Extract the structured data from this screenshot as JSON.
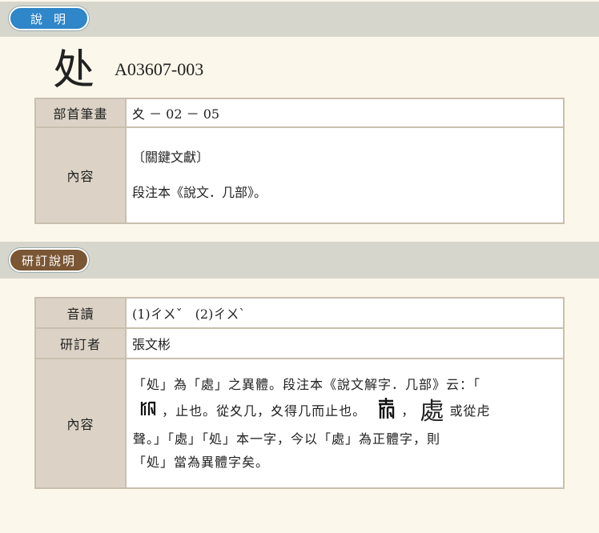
{
  "section1": {
    "tab_label": "說明"
  },
  "header": {
    "character": "处",
    "code": "A03607-003"
  },
  "table1": {
    "radical_label": "部首筆畫",
    "radical_value": "夊 － 02 － 05",
    "content_label": "內容",
    "content_line1": "〔關鍵文獻〕",
    "content_line2": "段注本《說文．几部》。"
  },
  "section2": {
    "tab_label": "研訂說明"
  },
  "table2": {
    "pron_label": "音讀",
    "pron_value": "(1)ㄔㄨˇ　(2)ㄔㄨˋ",
    "reviser_label": "研訂者",
    "reviser_value": "張文彬",
    "content_label": "內容",
    "para_a": "「処」為「處」之異體。段注本《說文解字．几部》云：「",
    "para_b": "，止也。從夊几，夊得几而止也。",
    "para_c": "，",
    "para_d": "或從虍",
    "para_e": "聲。」「處」「処」本一字，今以「處」為正體字，則",
    "para_f": "「処」當為異體字矣。",
    "seal1_icon": "seal-script-chu-icon",
    "seal2_icon": "seal-script-chu-variant-icon",
    "chu_glyph_icon": "chu-glyph-icon"
  }
}
